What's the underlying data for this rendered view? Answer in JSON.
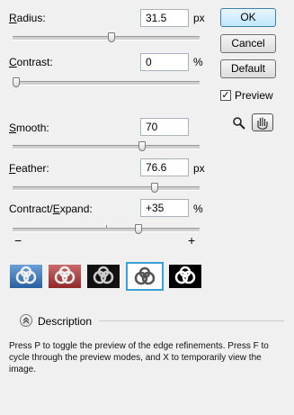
{
  "buttons": {
    "ok": "OK",
    "cancel": "Cancel",
    "default": "Default"
  },
  "preview": {
    "label": "Preview",
    "checked": true
  },
  "fields": [
    {
      "key": "radius",
      "label": "Radius:",
      "value": "31.5",
      "unit": "px",
      "level": 0.53
    },
    {
      "key": "contrast",
      "label": "Contrast:",
      "value": "0",
      "unit": "%",
      "level": 0.0
    },
    {
      "key": "smooth",
      "label": "Smooth:",
      "value": "70",
      "unit": "",
      "level": 0.7
    },
    {
      "key": "feather",
      "label": "Feather:",
      "value": "76.6",
      "unit": "px",
      "level": 0.77
    },
    {
      "key": "contract",
      "label": "Contract/Expand:",
      "value": "+35",
      "unit": "%",
      "level": 0.68
    }
  ],
  "minus_label": "−",
  "plus_label": "+",
  "preview_modes": [
    {
      "name": "standard",
      "bg": "#3a78c2"
    },
    {
      "name": "quick-mask",
      "bg": "#b84a4a"
    },
    {
      "name": "on-black",
      "bg": "#111111"
    },
    {
      "name": "on-white",
      "bg": "#ffffff",
      "selected": true
    },
    {
      "name": "mask",
      "bg": "#000000"
    }
  ],
  "description": {
    "title": "Description",
    "text": "Press P to toggle the preview of the edge refinements. Press F to cycle through the preview modes, and X to temporarily view the image."
  },
  "tools": [
    "zoom-tool",
    "hand-tool"
  ]
}
